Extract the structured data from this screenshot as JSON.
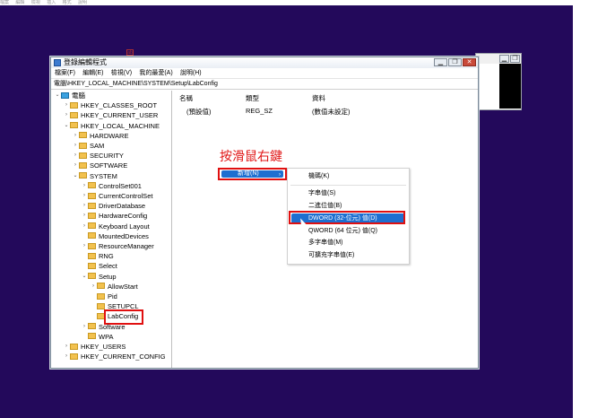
{
  "top_menu": [
    "檔案",
    "編輯",
    "檢視",
    "插入",
    "格式",
    "說明"
  ],
  "window": {
    "title": "登錄編輯程式",
    "buttons": {
      "minimize": "▁",
      "maximize": "❐",
      "close": "✕"
    },
    "menu": [
      "檔案(F)",
      "編輯(E)",
      "檢視(V)",
      "我的最愛(A)",
      "說明(H)"
    ],
    "address": "電腦\\HKEY_LOCAL_MACHINE\\SYSTEM\\Setup\\LabConfig"
  },
  "tree": [
    {
      "label": "電腦",
      "indent": 0,
      "chev": "v",
      "icon": "computer-icon"
    },
    {
      "label": "HKEY_CLASSES_ROOT",
      "indent": 1,
      "chev": ">",
      "icon": "folder-icon"
    },
    {
      "label": "HKEY_CURRENT_USER",
      "indent": 1,
      "chev": ">",
      "icon": "folder-icon"
    },
    {
      "label": "HKEY_LOCAL_MACHINE",
      "indent": 1,
      "chev": "v",
      "icon": "folder-icon"
    },
    {
      "label": "HARDWARE",
      "indent": 2,
      "chev": ">",
      "icon": "folder-icon"
    },
    {
      "label": "SAM",
      "indent": 2,
      "chev": ">",
      "icon": "folder-icon"
    },
    {
      "label": "SECURITY",
      "indent": 2,
      "chev": ">",
      "icon": "folder-icon"
    },
    {
      "label": "SOFTWARE",
      "indent": 2,
      "chev": ">",
      "icon": "folder-icon"
    },
    {
      "label": "SYSTEM",
      "indent": 2,
      "chev": "v",
      "icon": "folder-icon"
    },
    {
      "label": "ControlSet001",
      "indent": 3,
      "chev": ">",
      "icon": "folder-icon"
    },
    {
      "label": "CurrentControlSet",
      "indent": 3,
      "chev": ">",
      "icon": "folder-icon"
    },
    {
      "label": "DriverDatabase",
      "indent": 3,
      "chev": ">",
      "icon": "folder-icon"
    },
    {
      "label": "HardwareConfig",
      "indent": 3,
      "chev": ">",
      "icon": "folder-icon"
    },
    {
      "label": "Keyboard Layout",
      "indent": 3,
      "chev": ">",
      "icon": "folder-icon"
    },
    {
      "label": "MountedDevices",
      "indent": 3,
      "chev": "",
      "icon": "folder-icon"
    },
    {
      "label": "ResourceManager",
      "indent": 3,
      "chev": ">",
      "icon": "folder-icon"
    },
    {
      "label": "RNG",
      "indent": 3,
      "chev": "",
      "icon": "folder-icon"
    },
    {
      "label": "Select",
      "indent": 3,
      "chev": "",
      "icon": "folder-icon"
    },
    {
      "label": "Setup",
      "indent": 3,
      "chev": "v",
      "icon": "folder-icon"
    },
    {
      "label": "AllowStart",
      "indent": 4,
      "chev": ">",
      "icon": "folder-icon"
    },
    {
      "label": "Pid",
      "indent": 4,
      "chev": "",
      "icon": "folder-icon"
    },
    {
      "label": "SETUPCL",
      "indent": 4,
      "chev": "",
      "icon": "folder-icon"
    },
    {
      "label": "LabConfig",
      "indent": 4,
      "chev": "",
      "icon": "folder-icon",
      "selected": true
    },
    {
      "label": "Software",
      "indent": 3,
      "chev": ">",
      "icon": "folder-icon"
    },
    {
      "label": "WPA",
      "indent": 3,
      "chev": "",
      "icon": "folder-icon"
    },
    {
      "label": "HKEY_USERS",
      "indent": 1,
      "chev": ">",
      "icon": "folder-icon"
    },
    {
      "label": "HKEY_CURRENT_CONFIG",
      "indent": 1,
      "chev": ">",
      "icon": "folder-icon"
    }
  ],
  "list": {
    "headers": {
      "name": "名稱",
      "type": "類型",
      "data": "資料"
    },
    "row": {
      "name": "(預設值)",
      "type": "REG_SZ",
      "data": "(數值未設定)",
      "icon_text": "ab"
    }
  },
  "annotation": "按滑鼠右鍵",
  "new_button": {
    "label": "新增(N)",
    "arrow": "›"
  },
  "context_menu": [
    {
      "label": "機碼(K)"
    },
    {
      "separator": true
    },
    {
      "label": "字串值(S)"
    },
    {
      "label": "二進位值(B)"
    },
    {
      "label": "DWORD (32-位元) 值(D)",
      "highlighted": true
    },
    {
      "label": "QWORD (64 位元) 值(Q)"
    },
    {
      "label": "多字串值(M)"
    },
    {
      "label": "可擴充字串值(E)"
    }
  ],
  "colors": {
    "desktop": "#23095b",
    "highlight": "#1e6fd0",
    "annotation_red": "#e01010",
    "folder": "#f2c14e"
  }
}
